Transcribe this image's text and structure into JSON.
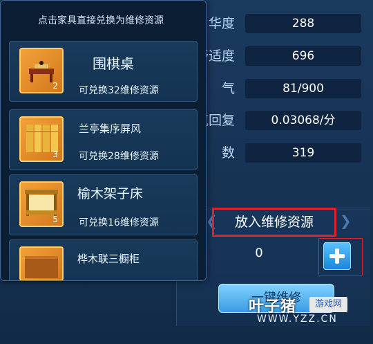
{
  "popup": {
    "title": "点击家具直接兑换为维修资源",
    "items": [
      {
        "name": "围棋桌",
        "desc": "可兑换32维修资源",
        "qty": "2"
      },
      {
        "name": "兰亭集序屏风",
        "desc": "可兑换28维修资源",
        "qty": "3"
      },
      {
        "name": "榆木架子床",
        "desc": "可兑换16维修资源",
        "qty": "5"
      },
      {
        "name": "桦木联三橱柜",
        "desc": "",
        "qty": ""
      }
    ]
  },
  "stats": [
    {
      "label": "华度",
      "value": "288"
    },
    {
      "label": "舒适度",
      "value": "696"
    },
    {
      "label": "气",
      "value": "81/900"
    },
    {
      "label": "气回复",
      "value": "0.03068/分"
    },
    {
      "label": "数",
      "value": "319"
    }
  ],
  "resource": {
    "banner": "放入维修资源",
    "count": "0",
    "button": "一键维修"
  },
  "watermark": {
    "logo": "叶子猪",
    "tag": "游戏网",
    "url": "WWW.YZZ.CN"
  },
  "colors": {
    "highlight": "#e0222a",
    "accent": "#3a9be3"
  }
}
